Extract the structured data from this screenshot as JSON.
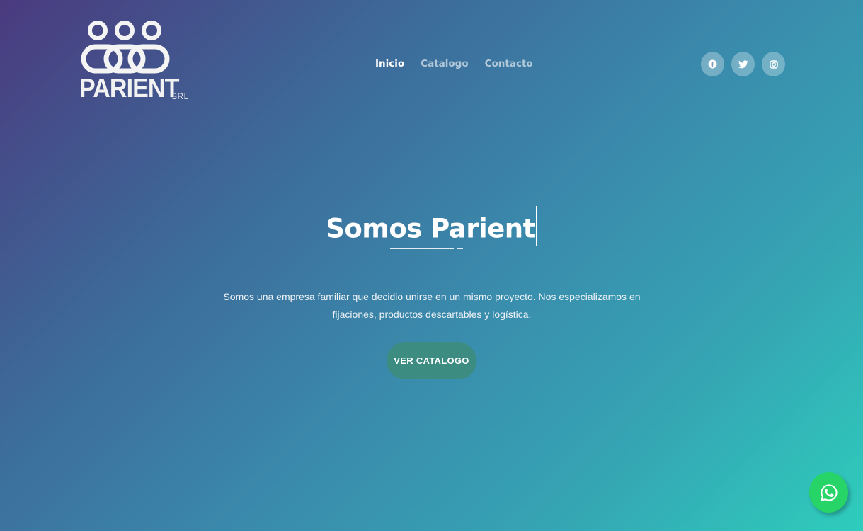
{
  "brand": {
    "name": "PARIENT",
    "suffix": "SRL",
    "logo_icon": "chain-people-logo"
  },
  "nav": {
    "items": [
      {
        "label": "Inicio",
        "active": true
      },
      {
        "label": "Catalogo",
        "active": false
      },
      {
        "label": "Contacto",
        "active": false
      }
    ]
  },
  "social": [
    {
      "icon": "facebook-icon"
    },
    {
      "icon": "twitter-icon"
    },
    {
      "icon": "instagram-icon"
    }
  ],
  "hero": {
    "title": "Somos Parient",
    "description": "Somos una empresa familiar que decidio unirse en un mismo proyecto. Nos especializamos en fijaciones, productos descartables y logística.",
    "cta_label": "VER CATALOGO"
  },
  "floating": {
    "icon": "whatsapp-icon"
  },
  "colors": {
    "gradient_start": "#4a3a7e",
    "gradient_end": "#2ecdbc",
    "cta_bg": "#3c8c82",
    "whatsapp": "#27d467"
  }
}
